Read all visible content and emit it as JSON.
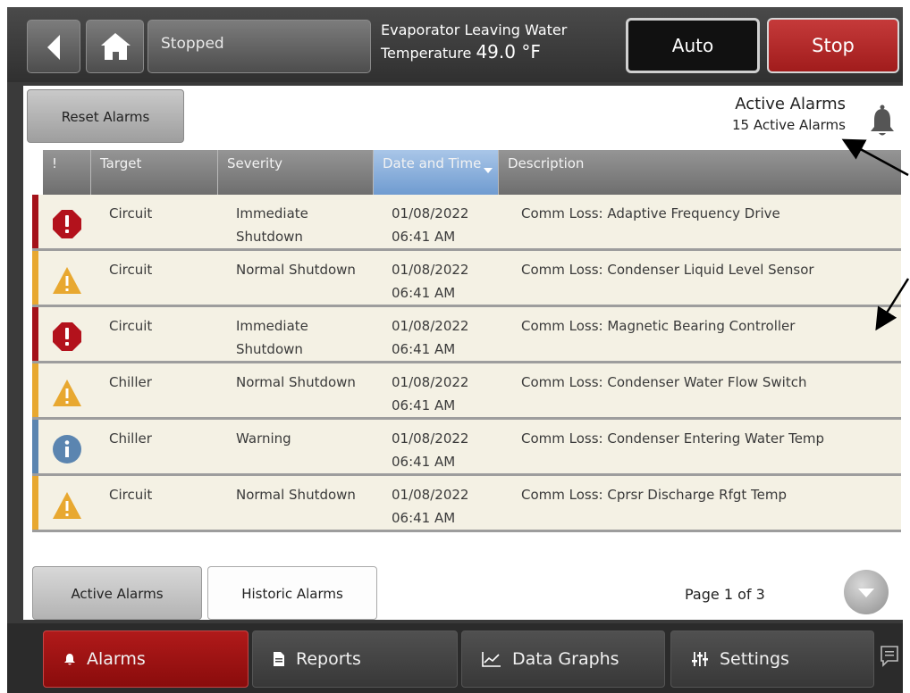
{
  "header": {
    "status": "Stopped",
    "evap_line1": "Evaporator Leaving Water",
    "evap_line2_prefix": "Temperature ",
    "evap_value": "49.0 °F",
    "auto_label": "Auto",
    "stop_label": "Stop"
  },
  "alarms_panel": {
    "reset_label": "Reset Alarms",
    "title": "Active Alarms",
    "count_text": "15 Active Alarms"
  },
  "table": {
    "columns": [
      "!",
      "Target",
      "Severity",
      "Date and Time",
      "Description"
    ],
    "sorted_column": "Date and Time",
    "rows": [
      {
        "icon": "error-icon",
        "color": "#a4121a",
        "target": "Circuit",
        "severity": "Immediate Shutdown",
        "date": "01/08/2022",
        "time": "06:41 AM",
        "description": "Comm Loss: Adaptive Frequency Drive"
      },
      {
        "icon": "warning-icon",
        "color": "#e8a830",
        "target": "Circuit",
        "severity": "Normal Shutdown",
        "date": "01/08/2022",
        "time": "06:41 AM",
        "description": "Comm Loss: Condenser Liquid Level Sensor"
      },
      {
        "icon": "error-icon",
        "color": "#a4121a",
        "target": "Circuit",
        "severity": "Immediate Shutdown",
        "date": "01/08/2022",
        "time": "06:41 AM",
        "description": "Comm Loss: Magnetic Bearing Controller"
      },
      {
        "icon": "warning-icon",
        "color": "#e8a830",
        "target": "Chiller",
        "severity": "Normal Shutdown",
        "date": "01/08/2022",
        "time": "06:41 AM",
        "description": "Comm Loss: Condenser Water Flow Switch"
      },
      {
        "icon": "info-icon",
        "color": "#5b85b0",
        "target": "Chiller",
        "severity": "Warning",
        "date": "01/08/2022",
        "time": "06:41 AM",
        "description": "Comm Loss: Condenser Entering Water Temp"
      },
      {
        "icon": "warning-icon",
        "color": "#e8a830",
        "target": "Circuit",
        "severity": "Normal Shutdown",
        "date": "01/08/2022",
        "time": "06:41 AM",
        "description": "Comm Loss: Cprsr Discharge Rfgt Temp"
      }
    ]
  },
  "footer": {
    "tab_active": "Active Alarms",
    "tab_historic": "Historic Alarms",
    "page_text": "Page 1 of 3"
  },
  "nav": {
    "alarms": "Alarms",
    "reports": "Reports",
    "data_graphs": "Data Graphs",
    "settings": "Settings"
  }
}
